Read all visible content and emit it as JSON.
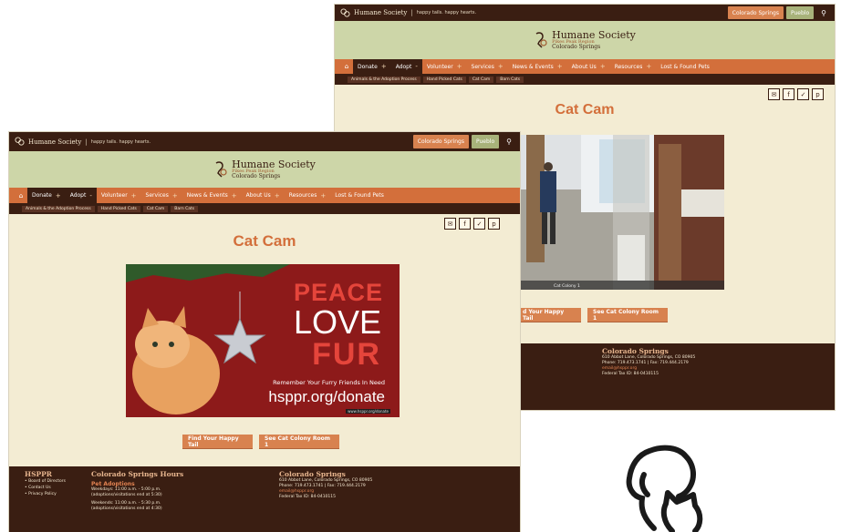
{
  "topbar": {
    "brand": "Humane Society",
    "tagline": "happy tails. happy hearts.",
    "location_cs": "Colorado Springs",
    "location_pueblo": "Pueblo",
    "search_icon": "search-icon"
  },
  "header": {
    "org_name": "Humane Society",
    "org_sub": "Pikes Peak Region",
    "city": "Colorado Springs"
  },
  "nav": {
    "items": [
      "Donate",
      "Adopt",
      "Volunteer",
      "Services",
      "News & Events",
      "About Us",
      "Resources",
      "Lost & Found Pets"
    ],
    "sub_items": [
      "Animals & the Adoption Process",
      "Hand Picked Cats",
      "Cat Cam",
      "Barn Cats"
    ]
  },
  "share_icons": [
    "mail-icon",
    "facebook-icon",
    "twitter-icon",
    "pinterest-icon"
  ],
  "page": {
    "title": "Cat Cam",
    "cam_caption": "Cat Colony 1",
    "btn_happy_tail": "Find Your Happy Tail",
    "btn_happy_tail_partial": "d Your Happy Tail",
    "btn_cat_colony": "See Cat Colony Room 1"
  },
  "promo": {
    "line1": "PEACE",
    "line2": "LOVE",
    "line3": "FUR",
    "remember": "Remember Your Furry Friends In Need",
    "url": "hsppr.org/donate",
    "tiny": "www.hsppr.org/donate"
  },
  "footer": {
    "org": "HSPPR",
    "links": [
      "Board of Directors",
      "Contact Us",
      "Privacy Policy"
    ],
    "hours_title": "Colorado Springs Hours",
    "hours_sub": "Pet Adoptions",
    "weekdays": "Weekdays: 11:00 a.m. - 5:00 p.m.",
    "weekdays_note": "(adoptions/visitations end at 5:30)",
    "weekends": "Weekends: 11:00 a.m. - 5:30 p.m.",
    "weekends_note": "(adoptions/visitations end at 4:30)",
    "cs_title": "Colorado Springs",
    "address": "610 Abbot Lane, Colorado Springs, CO 80905",
    "phone": "Phone: 719.473.1741 | Fax: 719.444.2179",
    "email": "email@hsppr.org",
    "federal": "Federal Tax ID: 84-0410115"
  },
  "colors": {
    "dark_brown": "#3a1e12",
    "orange": "#d36f3b",
    "olive": "#cdd6a8",
    "cream": "#f3ecd3"
  }
}
